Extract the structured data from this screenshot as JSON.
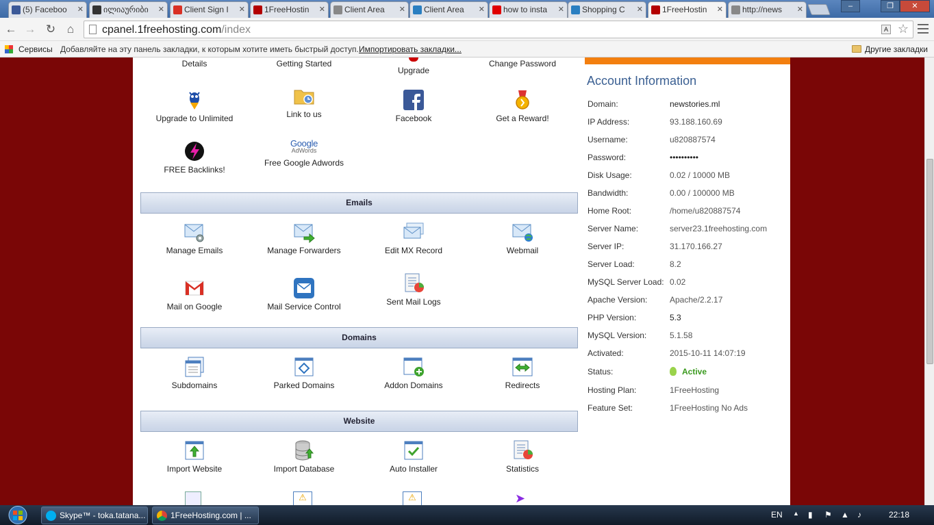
{
  "browser": {
    "tabs": [
      {
        "label": "(5) Faceboo",
        "icon": "facebook-icon",
        "color": "#3b5998"
      },
      {
        "label": "ილიაურიბი",
        "icon": "georgian-site-icon",
        "color": "#333333"
      },
      {
        "label": "Client Sign I",
        "icon": "gmail-icon",
        "color": "#d93025"
      },
      {
        "label": "1FreeHostin",
        "icon": "1freehosting-icon",
        "color": "#b30000"
      },
      {
        "label": "Client Area",
        "icon": "page-icon",
        "color": "#888888"
      },
      {
        "label": "Client Area",
        "icon": "fn-icon",
        "color": "#2a7fc1"
      },
      {
        "label": "how to insta",
        "icon": "youtube-icon",
        "color": "#e00000"
      },
      {
        "label": "Shopping C",
        "icon": "fn-icon",
        "color": "#2a7fc1"
      },
      {
        "label": "1FreeHostin",
        "icon": "1freehosting-icon",
        "color": "#b30000"
      },
      {
        "label": "http://news",
        "icon": "page-icon",
        "color": "#888888"
      }
    ],
    "url_host": "cpanel.1freehosting.com",
    "url_path": "/index",
    "bookmarks": {
      "apps": "Сервисы",
      "hint": "Добавляйте на эту панель закладки, к которым хотите иметь быстрый доступ.",
      "import_link": "Импортировать закладки...",
      "other": "Другие закладки"
    }
  },
  "top_items": [
    "Details",
    "Getting Started",
    "Upgrade",
    "Change Password"
  ],
  "features": [
    {
      "label": "Upgrade to Unlimited",
      "icon": "hostgator-mascot-icon"
    },
    {
      "label": "Link to us",
      "icon": "folder-link-icon"
    },
    {
      "label": "Facebook",
      "icon": "facebook-icon"
    },
    {
      "label": "Get a Reward!",
      "icon": "reward-medal-icon"
    },
    {
      "label": "FREE Backlinks!",
      "icon": "lightning-icon"
    },
    {
      "label": "Free Google Adwords",
      "icon": "google-adwords-icon",
      "logo_text": "Google",
      "logo_sub": "AdWords"
    }
  ],
  "sections": {
    "emails": {
      "title": "Emails",
      "items": [
        {
          "label": "Manage Emails",
          "icon": "envelope-gear-icon"
        },
        {
          "label": "Manage Forwarders",
          "icon": "envelope-arrow-icon"
        },
        {
          "label": "Edit MX Record",
          "icon": "envelopes-icon"
        },
        {
          "label": "Webmail",
          "icon": "envelope-globe-icon"
        },
        {
          "label": "Mail on Google",
          "icon": "gmail-icon"
        },
        {
          "label": "Mail Service Control",
          "icon": "mail-control-icon"
        },
        {
          "label": "Sent Mail Logs",
          "icon": "mail-logs-icon"
        }
      ]
    },
    "domains": {
      "title": "Domains",
      "items": [
        {
          "label": "Subdomains",
          "icon": "subdomains-icon"
        },
        {
          "label": "Parked Domains",
          "icon": "parked-domains-icon"
        },
        {
          "label": "Addon Domains",
          "icon": "addon-domains-icon"
        },
        {
          "label": "Redirects",
          "icon": "redirects-icon"
        }
      ]
    },
    "website": {
      "title": "Website",
      "items": [
        {
          "label": "Import Website",
          "icon": "import-website-icon"
        },
        {
          "label": "Import Database",
          "icon": "import-database-icon"
        },
        {
          "label": "Auto Installer",
          "icon": "auto-installer-icon"
        },
        {
          "label": "Statistics",
          "icon": "statistics-icon"
        }
      ]
    }
  },
  "account": {
    "title": "Account Information",
    "rows": [
      {
        "k": "Domain:",
        "v": "newstories.ml"
      },
      {
        "k": "IP Address:",
        "v": "93.188.160.69"
      },
      {
        "k": "Username:",
        "v": "u820887574"
      },
      {
        "k": "Password:",
        "v": "••••••••••"
      },
      {
        "k": "Disk Usage:",
        "v": "0.02 / 10000 MB"
      },
      {
        "k": "Bandwidth:",
        "v": "0.00 / 100000 MB"
      },
      {
        "k": "Home Root:",
        "v": "/home/u820887574"
      },
      {
        "k": "Server Name:",
        "v": "server23.1freehosting.com"
      },
      {
        "k": "Server IP:",
        "v": "31.170.166.27"
      },
      {
        "k": "Server Load:",
        "v": "8.2"
      },
      {
        "k": "MySQL Server Load:",
        "v": "0.02"
      },
      {
        "k": "Apache Version:",
        "v": "Apache/2.2.17"
      },
      {
        "k": "PHP Version:",
        "v": "5.3"
      },
      {
        "k": "MySQL Version:",
        "v": "5.1.58"
      },
      {
        "k": "Activated:",
        "v": "2015-10-11 14:07:19"
      },
      {
        "k": "Status:",
        "v": "Active"
      },
      {
        "k": "Hosting Plan:",
        "v": "1FreeHosting"
      },
      {
        "k": "Feature Set:",
        "v": "1FreeHosting No Ads"
      }
    ]
  },
  "taskbar": {
    "items": [
      {
        "label": "Skype™ - toka.tatana...",
        "icon": "skype-icon"
      },
      {
        "label": "1FreeHosting.com | ...",
        "icon": "chrome-icon"
      }
    ],
    "lang": "EN",
    "clock": "22:18"
  }
}
